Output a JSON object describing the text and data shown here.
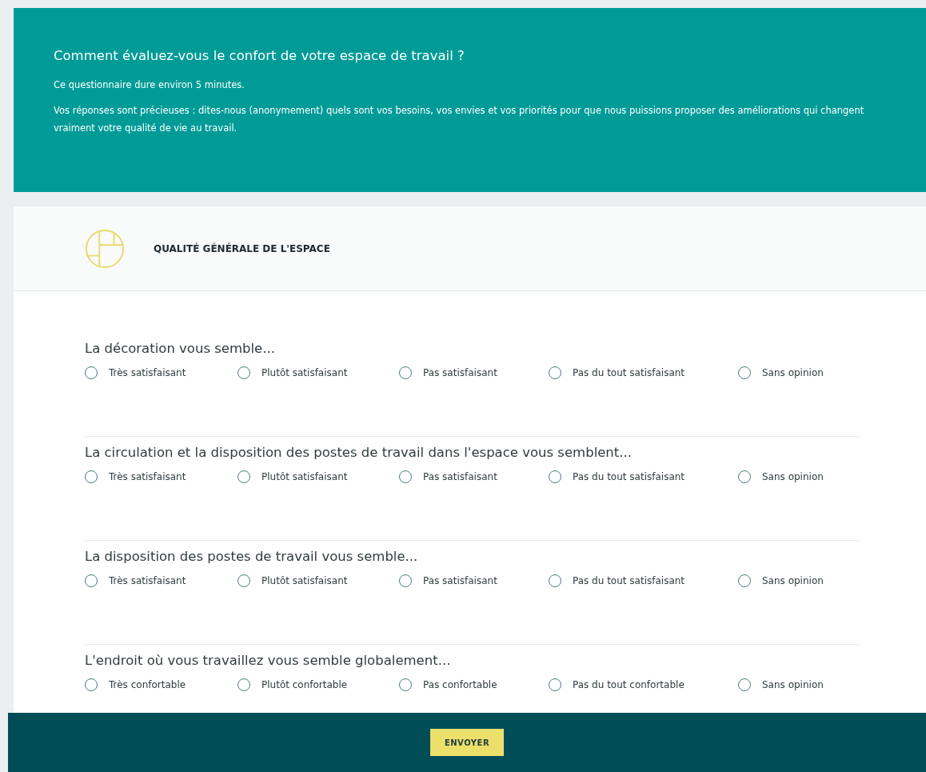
{
  "intro": {
    "title": "Comment évaluez-vous le confort de votre espace de travail ?",
    "paragraphs": [
      "Ce questionnaire dure environ 5 minutes.",
      "Vos réponses sont précieuses : dites-nous (anonymement) quels sont vos besoins, vos envies et vos priorités pour que nous puissions proposer des améliorations qui changent vraiment votre qualité de vie au travail."
    ]
  },
  "section": {
    "title": "QUALITÉ GÉNÉRALE DE L'ESPACE",
    "questions": [
      {
        "label": "La décoration vous semble...",
        "options": [
          {
            "label": "Très satisfaisant",
            "selected": false
          },
          {
            "label": "Plutôt satisfaisant",
            "selected": false
          },
          {
            "label": "Pas satisfaisant",
            "selected": false
          },
          {
            "label": "Pas du tout satisfaisant",
            "selected": false
          },
          {
            "label": "Sans opinion",
            "selected": false
          }
        ]
      },
      {
        "label": "La circulation et la disposition des postes de travail dans l'espace vous semblent...",
        "options": [
          {
            "label": "Très satisfaisant",
            "selected": false
          },
          {
            "label": "Plutôt satisfaisant",
            "selected": false
          },
          {
            "label": "Pas satisfaisant",
            "selected": false
          },
          {
            "label": "Pas du tout satisfaisant",
            "selected": false
          },
          {
            "label": "Sans opinion",
            "selected": false
          }
        ]
      },
      {
        "label": "La disposition des postes de travail vous semble...",
        "options": [
          {
            "label": "Très satisfaisant",
            "selected": false
          },
          {
            "label": "Plutôt satisfaisant",
            "selected": false
          },
          {
            "label": "Pas satisfaisant",
            "selected": false
          },
          {
            "label": "Pas du tout satisfaisant",
            "selected": false
          },
          {
            "label": "Sans opinion",
            "selected": false
          }
        ]
      },
      {
        "label": "L'endroit où vous travaillez vous semble globalement...",
        "options": [
          {
            "label": "Très confortable",
            "selected": false
          },
          {
            "label": "Plutôt confortable",
            "selected": false
          },
          {
            "label": "Pas confortable",
            "selected": false
          },
          {
            "label": "Pas du tout confortable",
            "selected": false
          },
          {
            "label": "Sans opinion",
            "selected": false
          }
        ]
      }
    ]
  },
  "footer": {
    "submit_button": "ENVOYER"
  }
}
